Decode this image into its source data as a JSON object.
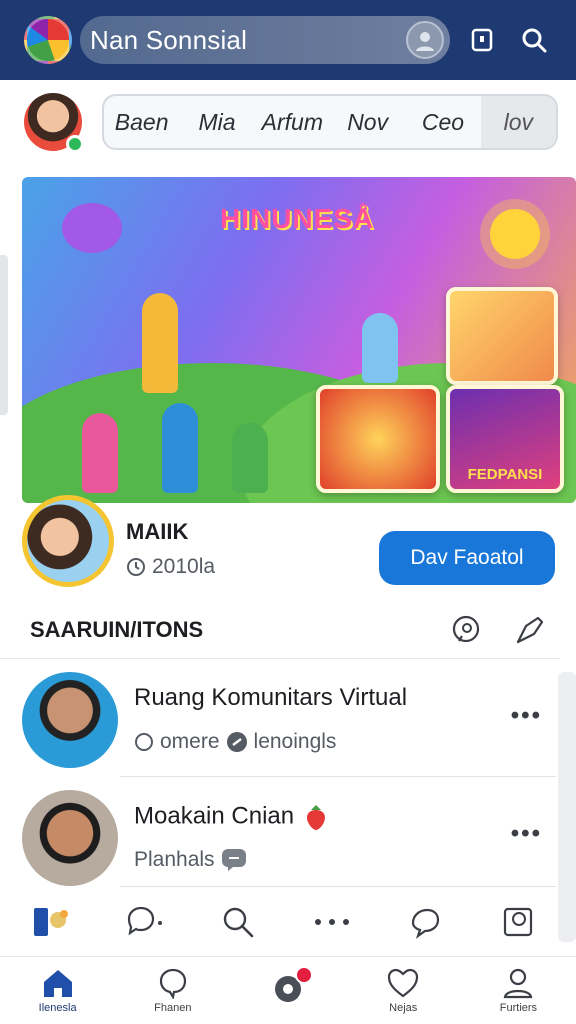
{
  "header": {
    "app_title": "Nan Sonnsial",
    "icons": [
      "app-logo",
      "profile-avatar",
      "bookmark-icon",
      "search-icon"
    ]
  },
  "chips": [
    "Baen",
    "Mia",
    "Arfum",
    "Nov",
    "Ceo",
    "lov"
  ],
  "banner": {
    "title": "HINUNESÅ",
    "card_label": "FEDPANSI"
  },
  "profile": {
    "name": "MAIIK",
    "subtitle": "2010la",
    "button_label": "Dav Faoatol"
  },
  "section": {
    "title": "SAARUIN/ITONS"
  },
  "posts": [
    {
      "name": "Ruang Komunitars Virtual",
      "meta_left": "omere",
      "meta_right": "lenoingls"
    },
    {
      "name": "Moakain Cnian",
      "meta_left": "Planhals",
      "meta_right": ""
    }
  ],
  "bottom_nav": [
    {
      "label": "Ilenesla",
      "icon": "home-icon"
    },
    {
      "label": "Fhanen",
      "icon": "chat-icon"
    },
    {
      "label": "",
      "icon": "notification-icon"
    },
    {
      "label": "Nejas",
      "icon": "heart-icon"
    },
    {
      "label": "Furtiers",
      "icon": "person-icon"
    }
  ],
  "colors": {
    "header_bg": "#1f3a72",
    "primary": "#1877d9",
    "badge": "#e41e3f"
  }
}
